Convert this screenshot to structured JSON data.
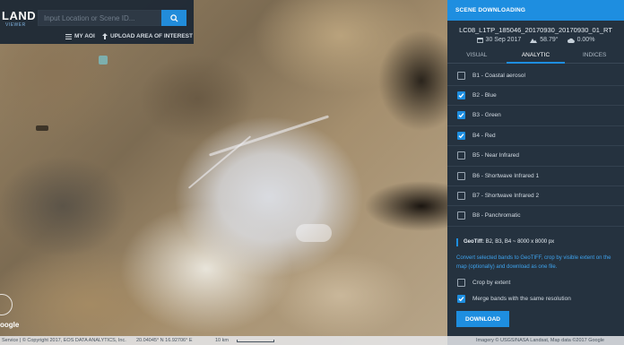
{
  "app": {
    "logo_text": "LAND",
    "logo_sub": "VIEWER"
  },
  "search": {
    "placeholder": "Input Location or Scene ID..."
  },
  "toolbar": {
    "my_aoi": "MY AOI",
    "upload_aoi": "UPLOAD AREA OF INTEREST"
  },
  "panel": {
    "title": "SCENE DOWNLOADING",
    "scene_id": "LC08_L1TP_185046_20170930_20170930_01_RT",
    "date": "30 Sep 2017",
    "sun_angle": "58.79°",
    "cloud": "0.00%",
    "tabs": [
      {
        "label": "VISUAL",
        "active": false
      },
      {
        "label": "ANALYTIC",
        "active": true
      },
      {
        "label": "INDICES",
        "active": false
      }
    ],
    "bands": [
      {
        "label": "B1 - Coastal aerosol",
        "checked": false
      },
      {
        "label": "B2 - Blue",
        "checked": true
      },
      {
        "label": "B3 - Green",
        "checked": true
      },
      {
        "label": "B4 - Red",
        "checked": true
      },
      {
        "label": "B5 - Near Infrared",
        "checked": false
      },
      {
        "label": "B6 - Shortwave Infrared 1",
        "checked": false
      },
      {
        "label": "B7 - Shortwave Infrared 2",
        "checked": false
      },
      {
        "label": "B8 - Panchromatic",
        "checked": false
      }
    ],
    "geotiff_label": "GeoTiff:",
    "geotiff_value": "B2, B3, B4 ~ 8000 x 8000 px",
    "description": "Convert selected bands to GeoTIFF, crop by visible extent on the map (optionally) and download as one file.",
    "options": [
      {
        "label": "Crop by extent",
        "checked": false
      },
      {
        "label": "Merge bands with the same resolution",
        "checked": true
      }
    ],
    "download_label": "DOWNLOAD"
  },
  "footer": {
    "left": "Service | © Copyright 2017, EOS DATA ANALYTICS, Inc.",
    "coords": "20.04045° N 16.92706° E",
    "scale": "10 km",
    "right": "Imagery © USGS/NASA Landsat, Map data ©2017 Google",
    "google": "oogle"
  },
  "colors": {
    "accent": "#1e8ee0",
    "panel_bg": "#25323f",
    "header_bg": "#1f2a36",
    "link": "#3ea3ee"
  }
}
